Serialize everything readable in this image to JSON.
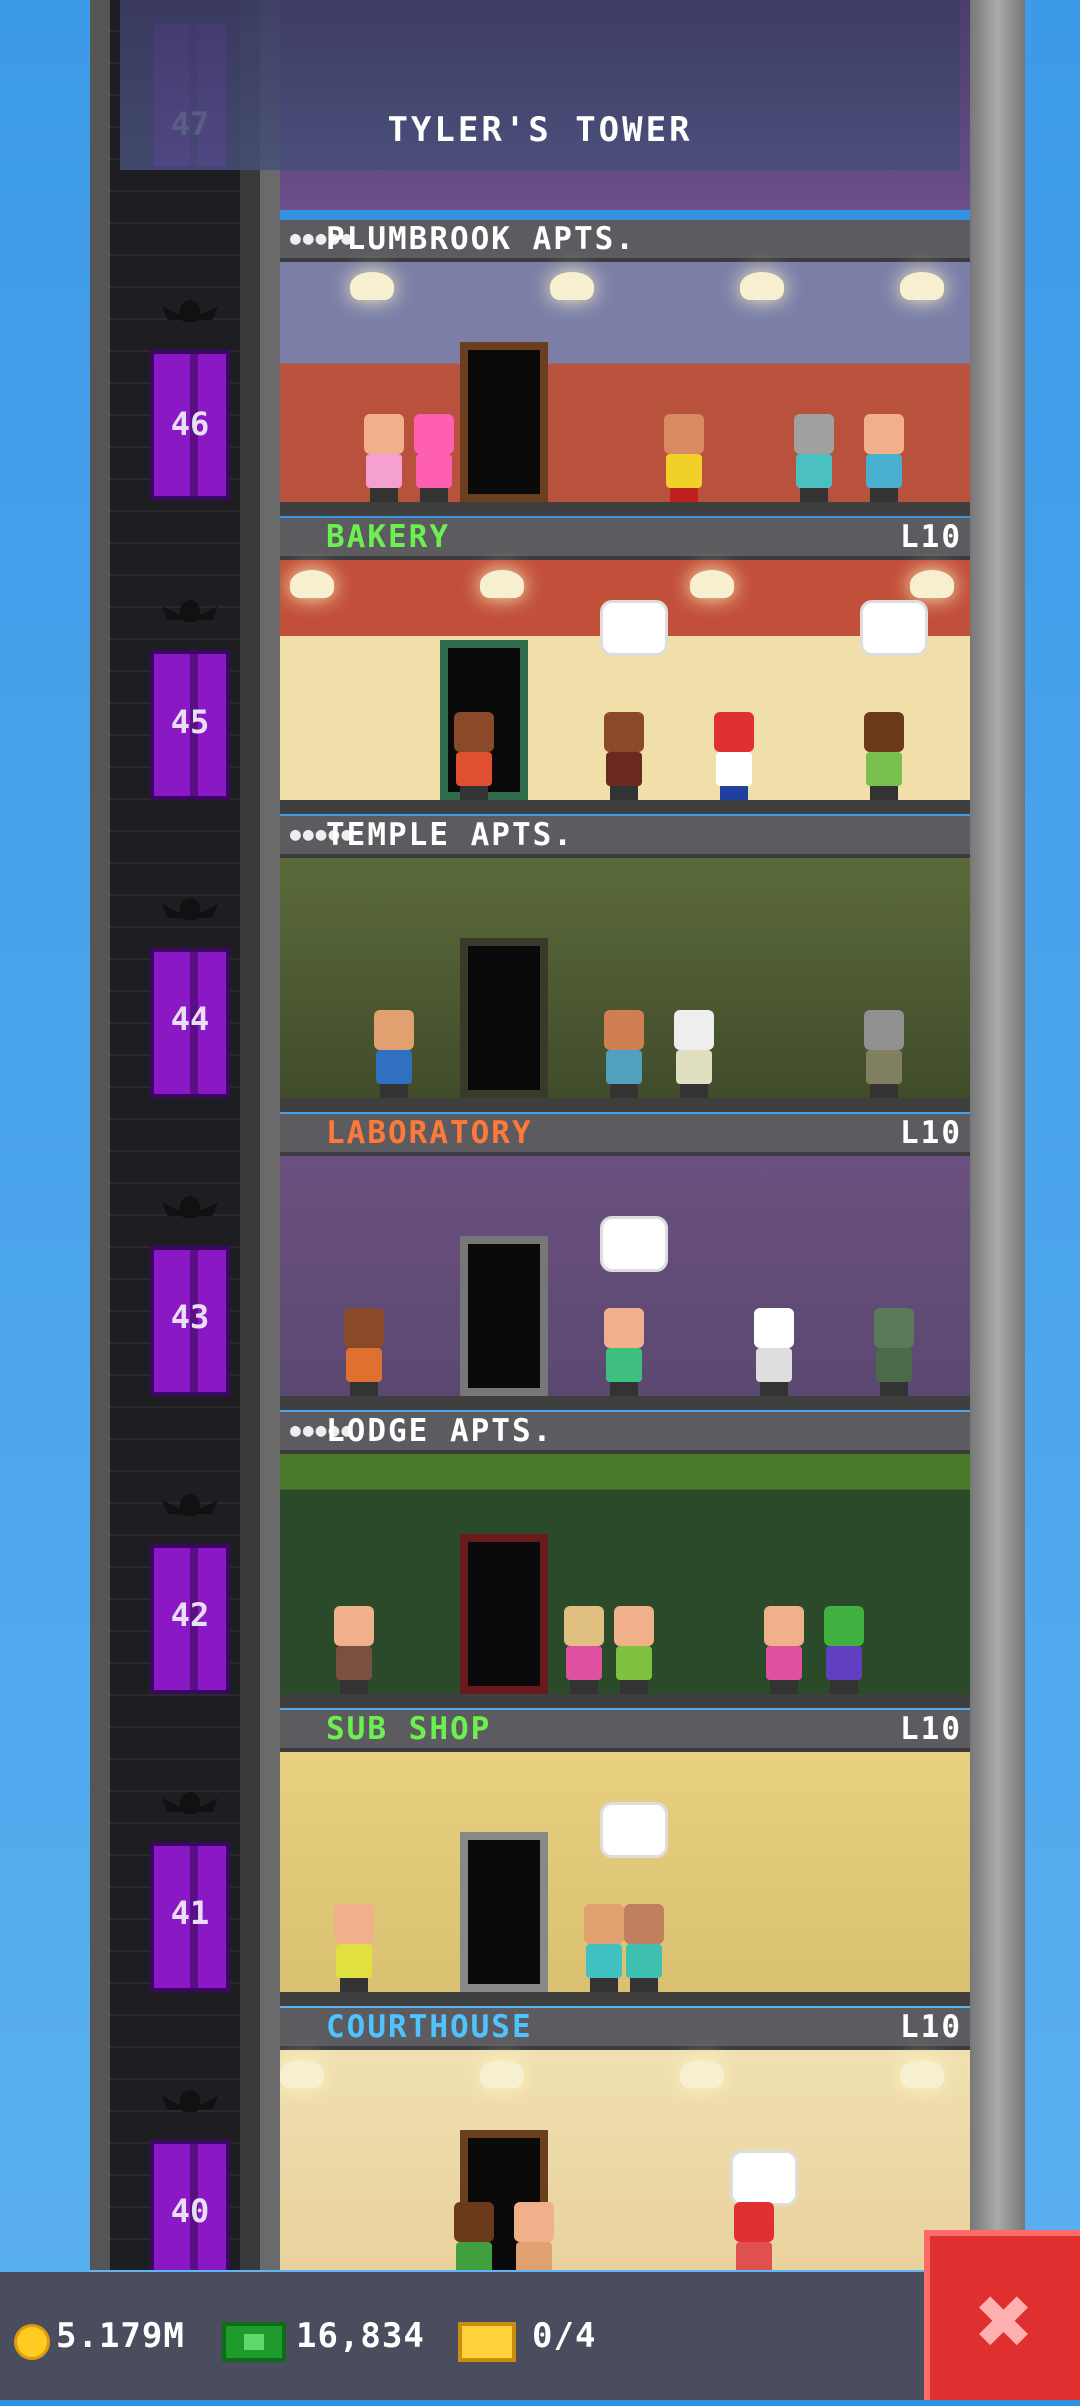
{
  "tower": {
    "name": "TYLER'S TOWER"
  },
  "floors": [
    {
      "number": "46",
      "name": "PLUMBROOK APTS.",
      "type": "apartment",
      "level": "",
      "residents_icon": "●●●●●",
      "name_color": "#ffffff"
    },
    {
      "number": "45",
      "name": "BAKERY",
      "type": "food",
      "level": "L10",
      "residents_icon": "",
      "name_color": "#6cf04f"
    },
    {
      "number": "44",
      "name": "TEMPLE APTS.",
      "type": "apartment",
      "level": "",
      "residents_icon": "●●●●●",
      "name_color": "#ffffff"
    },
    {
      "number": "43",
      "name": "LABORATORY",
      "type": "service",
      "level": "L10",
      "residents_icon": "",
      "name_color": "#ff7a3a"
    },
    {
      "number": "42",
      "name": "LODGE APTS.",
      "type": "apartment",
      "level": "",
      "residents_icon": "●●●●●",
      "name_color": "#ffffff"
    },
    {
      "number": "41",
      "name": "SUB SHOP",
      "type": "food",
      "level": "L10",
      "residents_icon": "",
      "name_color": "#6cf04f"
    },
    {
      "number": "40",
      "name": "COURTHOUSE",
      "type": "civic",
      "level": "L10",
      "residents_icon": "",
      "name_color": "#4fc3ff"
    }
  ],
  "top_floor_number": "47",
  "bottom_bar": {
    "coins": "5.179M",
    "bux": "16,834",
    "tickets": "0/4"
  },
  "icons": {
    "coin": "coin-icon",
    "bux": "bux-icon",
    "ticket": "ticket-icon",
    "close": "close-icon"
  },
  "close_button_label": "✖",
  "colors": {
    "elevator": "#8a18c4",
    "close_button": "#e02f2f",
    "bottom_bar": "#4a4d5e"
  }
}
